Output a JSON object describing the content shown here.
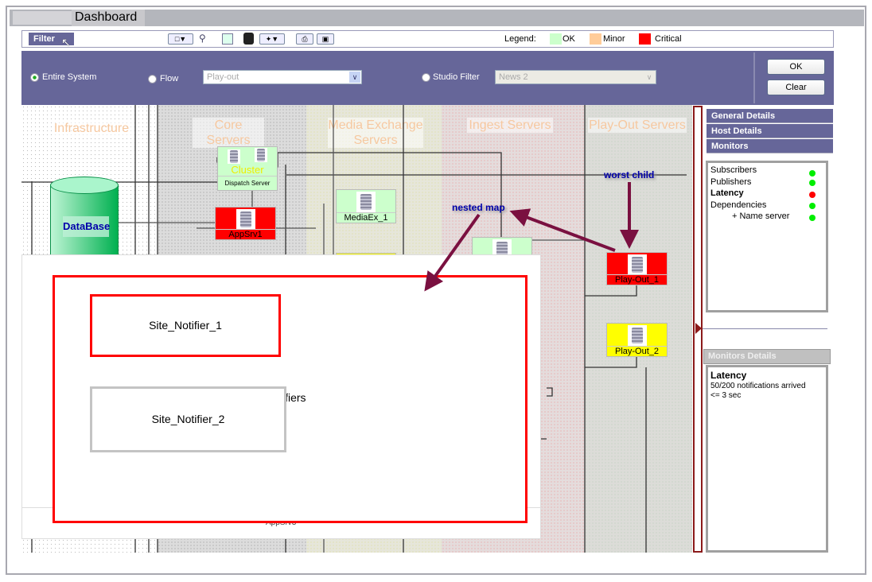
{
  "window": {
    "title": "Dashboard"
  },
  "toolbar": {
    "filter_label": "Filter",
    "icons": [
      "layout-dropdown-icon",
      "zoom-select-icon",
      "fit-to-screen-icon",
      "layers-icon",
      "pointer-dropdown-icon",
      "print-icon",
      "export-icon"
    ],
    "legend": {
      "label": "Legend:",
      "items": [
        {
          "label": "OK",
          "color": "#ccffcc"
        },
        {
          "label": "Minor",
          "color": "#ffcc99"
        },
        {
          "label": "Critical",
          "color": "#ff0000"
        }
      ]
    }
  },
  "filter": {
    "entire_system": "Entire System",
    "flow": "Flow",
    "flow_value": "Play-out",
    "studio_filter": "Studio Filter",
    "studio_value": "News 2",
    "ok": "OK",
    "clear": "Clear",
    "selected": "Entire System"
  },
  "map": {
    "columns": [
      "Infrastructure",
      "Core Servers",
      "Media Exchange Servers",
      "Ingest Servers",
      "Play-Out Servers"
    ],
    "nodes": {
      "database": "DataBase",
      "cluster": "Cluster",
      "dispatch": "Dispatch Server",
      "appsrv1": "AppSrv1",
      "mediaex1": "MediaEx_1",
      "playout1": "Play-Out_1",
      "playout2": "Play-Out_2",
      "appsrv3": "AppSrv3"
    },
    "status_colors": {
      "ok": "#ccffcc",
      "critical": "#ff0000",
      "warning": "#ffff00"
    },
    "annotations": {
      "nested_map": "nested map",
      "worst_child": "worst child"
    },
    "nested": {
      "site1": "Site_Notifier_1",
      "site2": "Site_Notifier_2",
      "group_label": "ifiers"
    }
  },
  "details": {
    "tabs": [
      "General Details",
      "Host Details",
      "Monitors"
    ],
    "monitors": [
      {
        "label": "Subscribers",
        "status": "ok"
      },
      {
        "label": "Publishers",
        "status": "ok"
      },
      {
        "label": "Latency",
        "status": "critical"
      },
      {
        "label": "Dependencies",
        "status": "ok"
      },
      {
        "label": "+ Name server",
        "status": "ok"
      }
    ],
    "monitors_details_title": "Monitors Details",
    "monitor_detail": {
      "name": "Latency",
      "line1": "50/200 notifications arrived",
      "line2": "<= 3 sec"
    }
  }
}
